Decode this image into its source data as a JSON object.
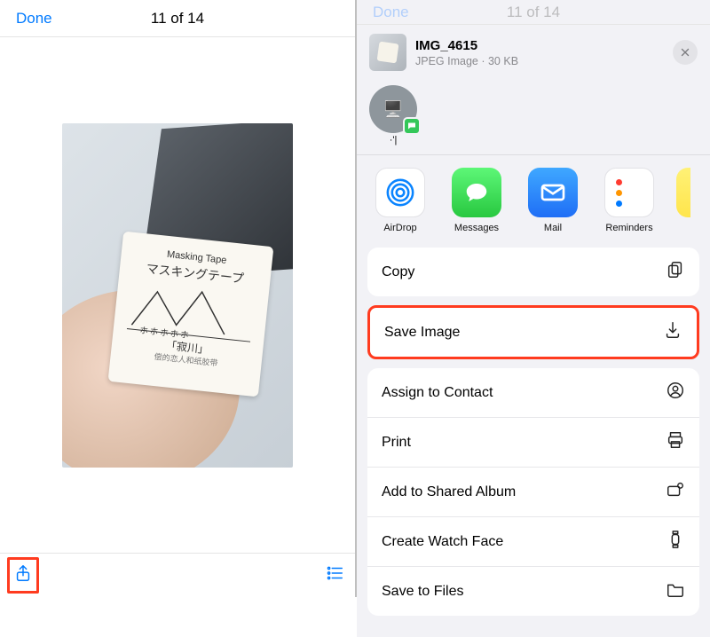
{
  "left": {
    "done_label": "Done",
    "counter": "11 of 14",
    "photo_box_lines": [
      "Masking Tape",
      "マスキングテープ",
      "「寂川」",
      "偿的恋人和纸胶带"
    ]
  },
  "sheet": {
    "header_faint": {
      "done": "Done",
      "counter": "11 of 14"
    },
    "file": {
      "name": "IMG_4615",
      "type": "JPEG Image",
      "size": "30 KB"
    },
    "contacts": [
      {
        "initials": "🖥️",
        "name": "·'|"
      }
    ],
    "apps": [
      {
        "label": "AirDrop",
        "bg": "#ffffff",
        "border": "#dcdce0"
      },
      {
        "label": "Messages",
        "bg": "#34c759"
      },
      {
        "label": "Mail",
        "bg": "#2584ff"
      },
      {
        "label": "Reminders",
        "bg": "#ffffff"
      }
    ],
    "copy_label": "Copy",
    "actions": [
      {
        "label": "Save Image",
        "icon": "download",
        "highlight": true
      },
      {
        "label": "Assign to Contact",
        "icon": "contact"
      },
      {
        "label": "Print",
        "icon": "print"
      },
      {
        "label": "Add to Shared Album",
        "icon": "shared-album"
      },
      {
        "label": "Create Watch Face",
        "icon": "watch"
      },
      {
        "label": "Save to Files",
        "icon": "folder"
      }
    ]
  }
}
